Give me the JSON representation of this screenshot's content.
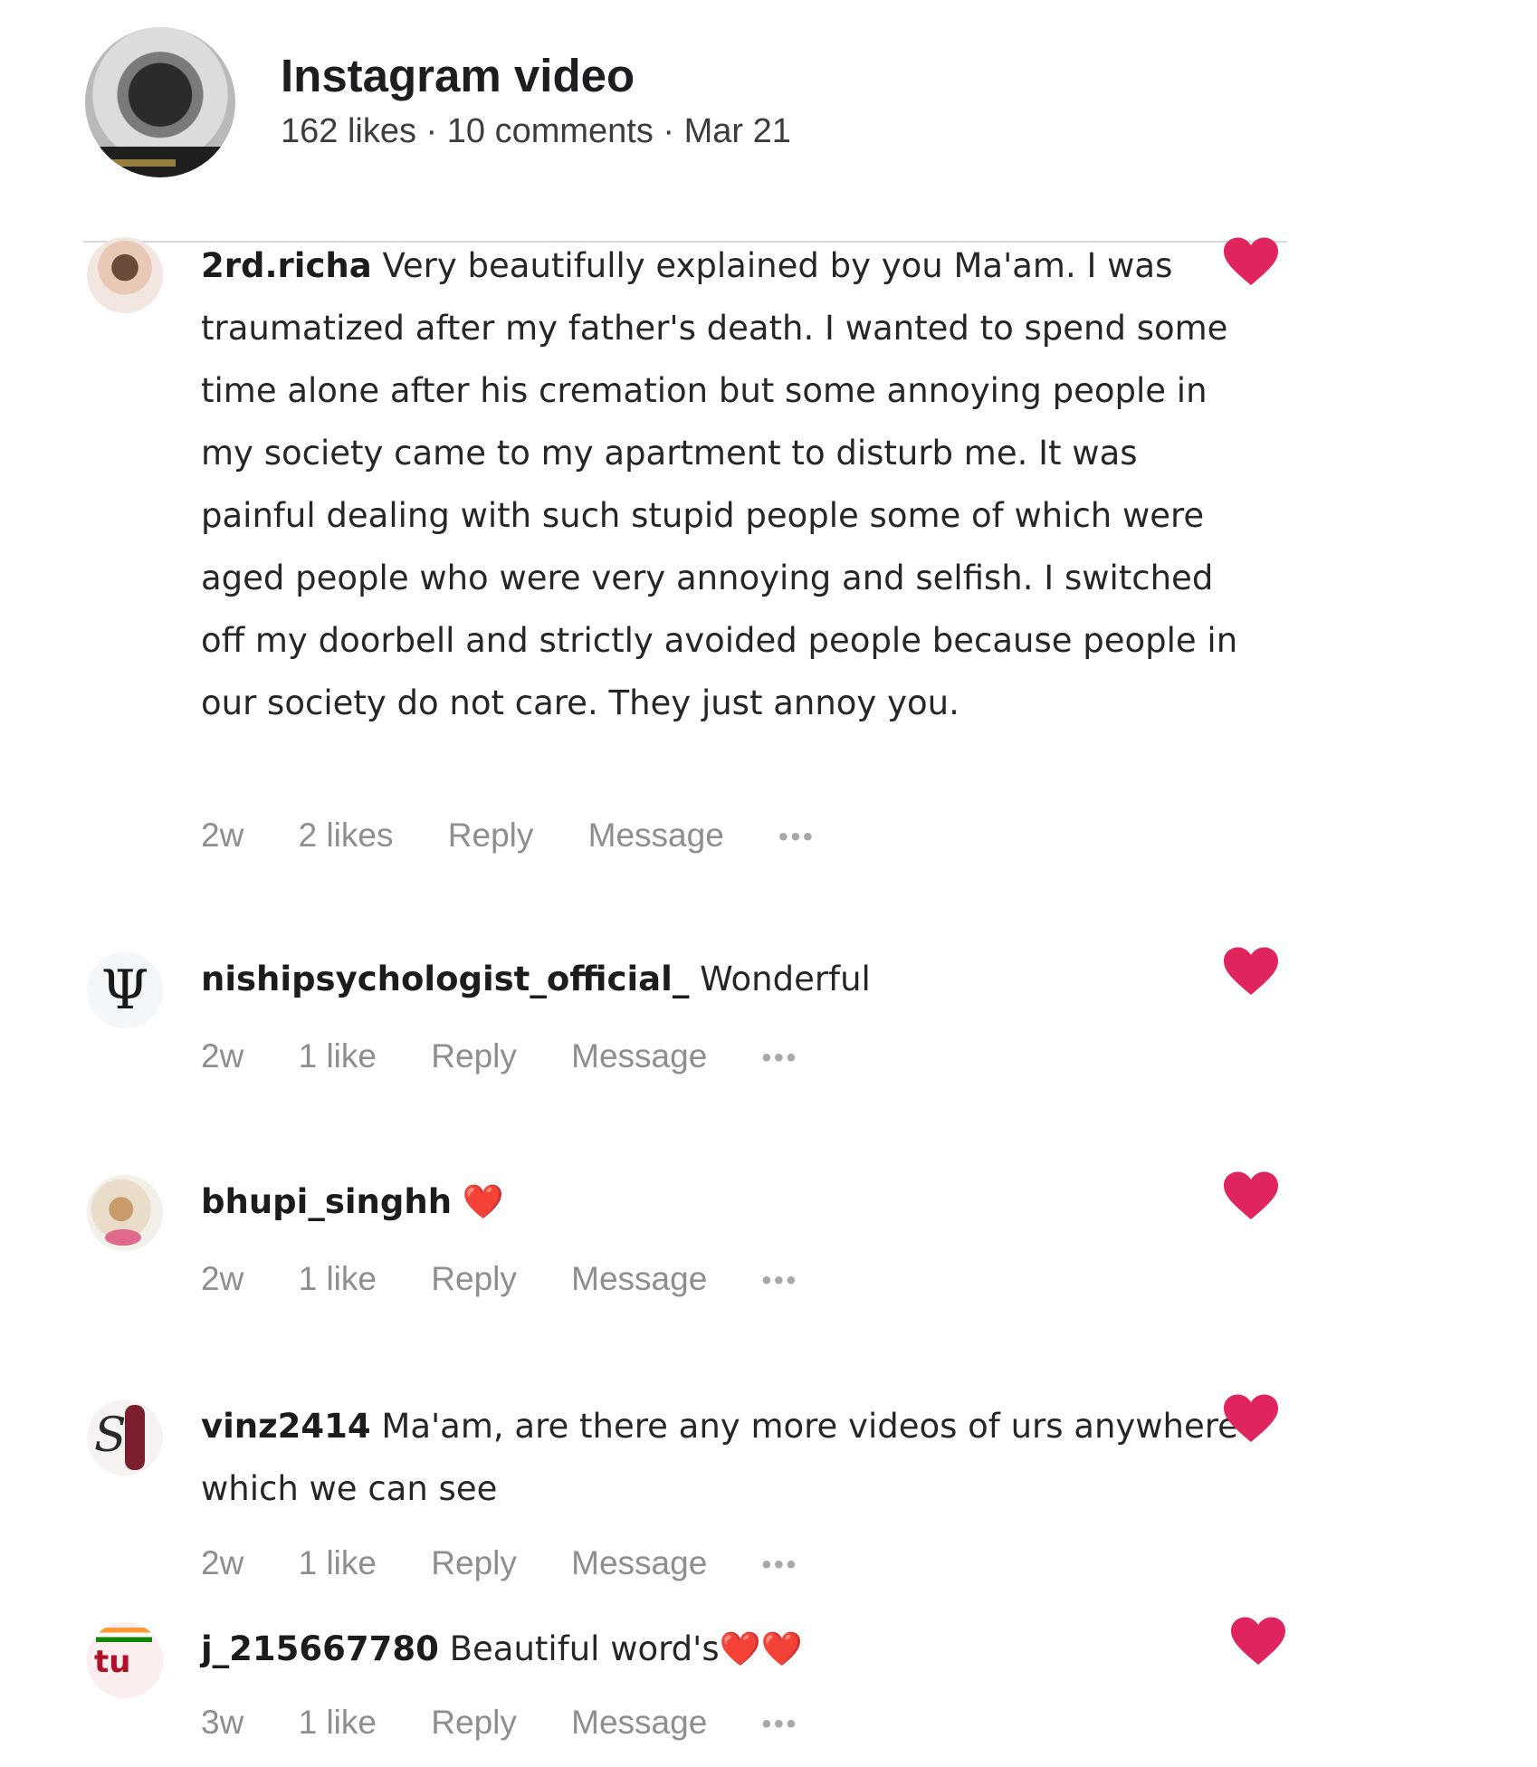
{
  "post": {
    "title": "Instagram video",
    "meta": "162 likes · 10 comments · Mar 21"
  },
  "comments": [
    {
      "username": "2rd.richa",
      "text": " Very beautifully explained by you Ma'am. I was traumatized after my father's death. I wanted to spend some time alone after his cremation but some annoying people in my society came to my apartment to disturb me. It was painful dealing with such stupid people some of which were aged people who were very annoying and selfish. I switched off my doorbell and strictly avoided people because people in our society do not care. They just annoy you.",
      "time": "2w",
      "likes": "2 likes",
      "reply": "Reply",
      "message": "Message",
      "more": "•••"
    },
    {
      "username": "nishipsychologist_official_",
      "text": " Wonderful",
      "avatar_glyph": "Ψ",
      "time": "2w",
      "likes": "1 like",
      "reply": "Reply",
      "message": "Message",
      "more": "•••"
    },
    {
      "username": "bhupi_singhh",
      "text": " ❤️",
      "time": "2w",
      "likes": "1 like",
      "reply": "Reply",
      "message": "Message",
      "more": "•••"
    },
    {
      "username": "vinz2414",
      "text": " Ma'am, are there any more videos of urs anywhere which we can see",
      "time": "2w",
      "likes": "1 like",
      "reply": "Reply",
      "message": "Message",
      "more": "•••"
    },
    {
      "username": "j_215667780",
      "text": " Beautiful word's❤️❤️",
      "time": "3w",
      "likes": "1 like",
      "reply": "Reply",
      "message": "Message",
      "more": "•••"
    }
  ],
  "colors": {
    "heart": "#e0245e",
    "meta_text": "#8e8e8e"
  },
  "icons": {
    "like": "heart-icon",
    "more": "more-options-icon"
  }
}
